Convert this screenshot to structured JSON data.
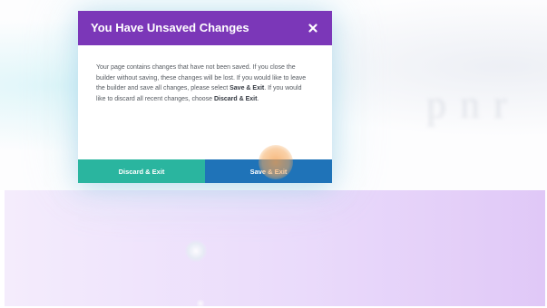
{
  "dialog": {
    "title": "You Have Unsaved Changes",
    "close_icon": "close-icon",
    "message": {
      "intro": "Your page contains changes that have not been saved. If you close the builder without saving, these changes will be lost. If you would like to leave the builder and save all changes, please select ",
      "save_emphasis": "Save & Exit",
      "middle": ". If you would like to discard all recent changes, choose ",
      "discard_emphasis": "Discard & Exit",
      "end": "."
    },
    "buttons": {
      "discard_label": "Discard & Exit",
      "save_label": "Save & Exit"
    }
  },
  "colors": {
    "header": "#7b37b8",
    "discard_button": "#2ab59f",
    "save_button": "#1f73b8",
    "click_indicator": "#f2a05a",
    "page_band": "#eadbfb"
  }
}
